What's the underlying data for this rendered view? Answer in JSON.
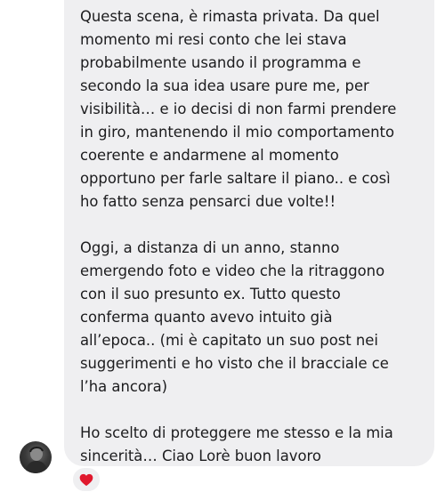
{
  "message": {
    "paragraphs": [
      "Questa scena, è rimasta privata. Da quel\nmomento mi resi conto che lei stava\nprobabilmente usando il programma e\nsecondo la sua idea usare pure me, per\nvisibilità… e io decisi di non farmi prendere\nin giro, mantenendo il mio comportamento\ncoerente e andarmene al momento\nopportuno per farle saltare il piano.. e così\nho fatto senza pensarci due volte!!",
      "Oggi, a distanza di un anno, stanno\nemergendo foto e video che la ritraggono\ncon il suo presunto ex. Tutto questo\nconferma quanto avevo intuito già\nall’epoca.. (mi è capitato un suo post nei\nsuggerimenti e ho visto che il bracciale ce\nl’ha ancora)",
      "Ho scelto di proteggere me stesso e la mia\nsincerità… Ciao Lorè buon lavoro"
    ]
  },
  "reaction": {
    "icon": "red-heart-icon",
    "color": "#e0182d"
  },
  "sender": {
    "avatar_icon": "profile-photo"
  },
  "colors": {
    "bubble": "#efeff1",
    "text": "#1c1c1e",
    "background": "#ffffff"
  }
}
